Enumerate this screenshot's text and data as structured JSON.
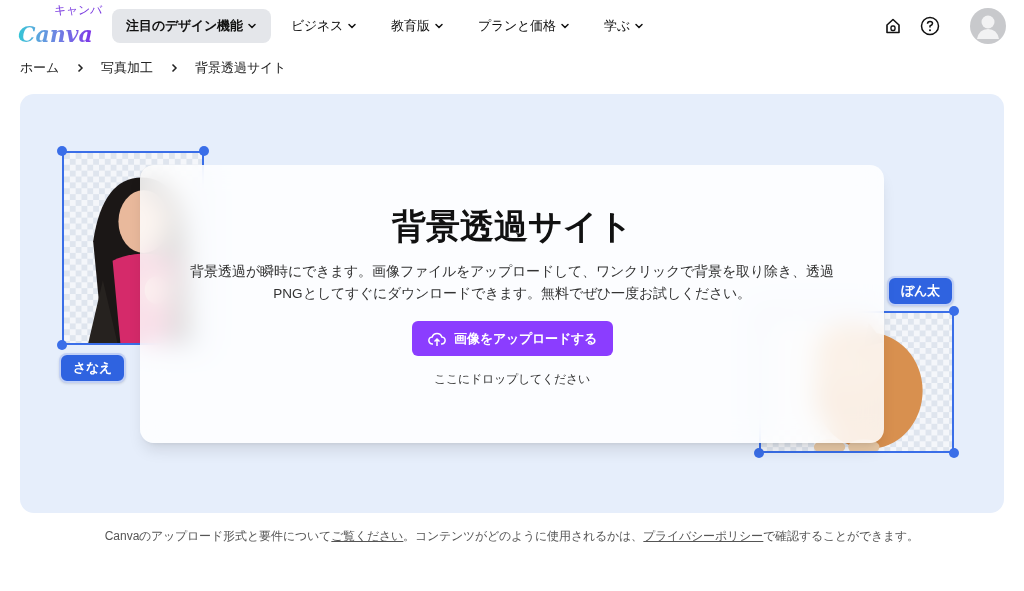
{
  "header": {
    "logo": {
      "wordmark": "Canva",
      "kana": "キャンバ"
    },
    "nav": [
      {
        "label": "注目のデザイン機能",
        "selected": true
      },
      {
        "label": "ビジネス",
        "selected": false
      },
      {
        "label": "教育版",
        "selected": false
      },
      {
        "label": "プラン",
        "selected": false,
        "label2": "と価格"
      },
      {
        "label": "学ぶ",
        "selected": false
      }
    ]
  },
  "breadcrumb": [
    "ホーム",
    "写真加工",
    "背景透過サイト"
  ],
  "hero": {
    "title": "背景透過サイト",
    "description": "背景透過が瞬時にできます。画像ファイルをアップロードして、ワンクリックで背景を取り除き、透過PNGとしてすぐにダウンロードできます。無料でぜひ一度お試しください。",
    "upload_button": "画像をアップロードする",
    "drop_hint": "ここにドロップしてください",
    "examples": [
      {
        "kind": "person",
        "tag": "さなえ"
      },
      {
        "kind": "dog",
        "tag": "ぼん太"
      }
    ]
  },
  "footer_note": [
    {
      "kind": "text",
      "text": "Canvaのアップロード形式と要件について"
    },
    {
      "kind": "link",
      "text": "ご覧ください"
    },
    {
      "kind": "text",
      "text": "。コンテンツがどのように使用されるかは、"
    },
    {
      "kind": "link",
      "text": "プライバシーポリシー"
    },
    {
      "kind": "text",
      "text": "で確認することができます。"
    }
  ]
}
